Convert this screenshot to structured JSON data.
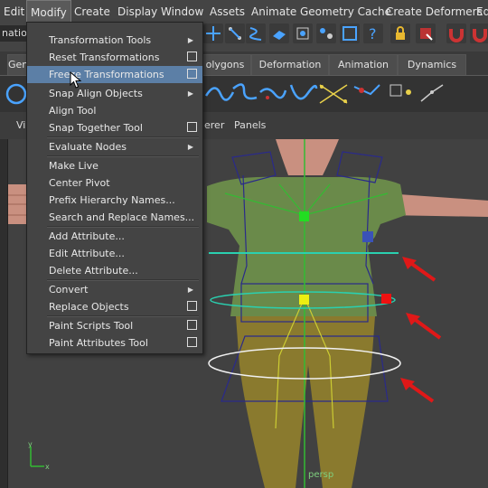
{
  "menubar": {
    "items": [
      "Edit",
      "Modify",
      "Create",
      "Display",
      "Window",
      "Assets",
      "Animate",
      "Geometry Cache",
      "Create Deformers",
      "Edi"
    ]
  },
  "status": {
    "menu_set": "nation"
  },
  "shelf_tabs": [
    "Gen",
    "olygons",
    "Deformation",
    "Animation",
    "Dynamics"
  ],
  "panel_menu": {
    "view": "Vie",
    "renderer": "erer",
    "panels": "Panels"
  },
  "viewport": {
    "camera_label": "persp"
  },
  "modify_menu": {
    "items": [
      {
        "label": "Transformation Tools",
        "submenu": true
      },
      {
        "label": "Reset Transformations",
        "option": true
      },
      {
        "label": "Freeze Transformations",
        "option": true,
        "highlighted": true
      },
      {
        "label": "Snap Align Objects",
        "submenu": true
      },
      {
        "label": "Align Tool"
      },
      {
        "label": "Snap Together Tool",
        "option": true
      },
      {
        "label": "Evaluate Nodes",
        "submenu": true
      },
      {
        "label": "Make Live"
      },
      {
        "label": "Center Pivot"
      },
      {
        "label": "Prefix Hierarchy Names..."
      },
      {
        "label": "Search and Replace Names..."
      },
      {
        "label": "Add Attribute..."
      },
      {
        "label": "Edit Attribute..."
      },
      {
        "label": "Delete Attribute..."
      },
      {
        "label": "Convert",
        "submenu": true
      },
      {
        "label": "Replace Objects",
        "option": true
      },
      {
        "label": "Paint Scripts Tool",
        "option": true
      },
      {
        "label": "Paint Attributes Tool",
        "option": true
      }
    ]
  },
  "colors": {
    "menu_highlight": "#5c7fa6",
    "annotation_arrow": "#e01818",
    "shirt": "#6a8a4a",
    "pants": "#8a7a2e"
  }
}
